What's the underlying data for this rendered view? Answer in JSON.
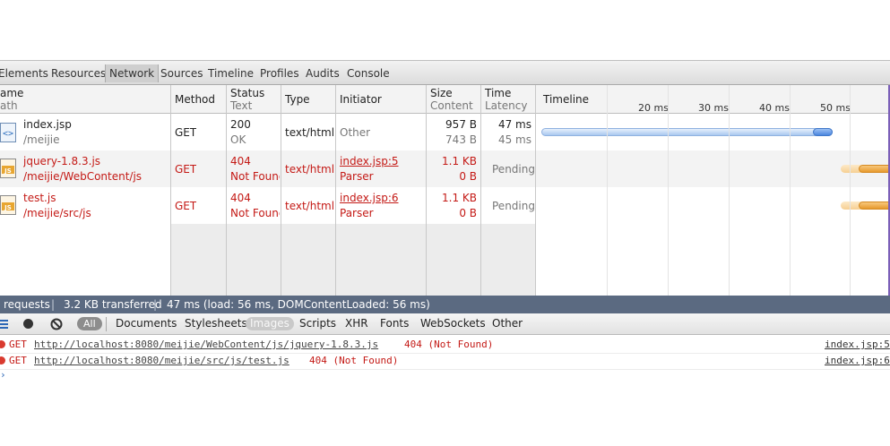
{
  "tabs": [
    "Elements",
    "Resources",
    "Network",
    "Sources",
    "Timeline",
    "Profiles",
    "Audits",
    "Console"
  ],
  "header": {
    "name": "ame",
    "path": "ath",
    "method": "Method",
    "status": "Status",
    "status_text": "Text",
    "type": "Type",
    "initiator": "Initiator",
    "size": "Size",
    "content": "Content",
    "time": "Time",
    "latency": "Latency",
    "timeline": "Timeline",
    "ticks": [
      "20 ms",
      "30 ms",
      "40 ms",
      "50 ms"
    ]
  },
  "rows": [
    {
      "name": "index.jsp",
      "path": "/meijie",
      "method": "GET",
      "status": "200",
      "status_text": "OK",
      "type": "text/html",
      "initiator": "Other",
      "initiator_sub": "",
      "size": "957 B",
      "content": "743 B",
      "time": "47 ms",
      "latency": "45 ms",
      "error": false
    },
    {
      "name": "jquery-1.8.3.js",
      "path": "/meijie/WebContent/js",
      "method": "GET",
      "status": "404",
      "status_text": "Not Found",
      "type": "text/html",
      "initiator": "index.jsp:5",
      "initiator_sub": "Parser",
      "size": "1.1 KB",
      "content": "0 B",
      "time": "Pending",
      "latency": "",
      "error": true
    },
    {
      "name": "test.js",
      "path": "/meijie/src/js",
      "method": "GET",
      "status": "404",
      "status_text": "Not Found",
      "type": "text/html",
      "initiator": "index.jsp:6",
      "initiator_sub": "Parser",
      "size": "1.1 KB",
      "content": "0 B",
      "time": "Pending",
      "latency": "",
      "error": true
    }
  ],
  "statusbar": {
    "requests": "requests",
    "transferred": "3.2 KB transferred",
    "timing": "47 ms (load: 56 ms, DOMContentLoaded: 56 ms)"
  },
  "filters": {
    "all": "All",
    "items": [
      "Documents",
      "Stylesheets",
      "Images",
      "Scripts",
      "XHR",
      "Fonts",
      "WebSockets",
      "Other"
    ]
  },
  "console": [
    {
      "method": "GET",
      "url": "http://localhost:8080/meijie/WebContent/js/jquery-1.8.3.js",
      "status": "404 (Not Found)",
      "source": "index.jsp:5"
    },
    {
      "method": "GET",
      "url": "http://localhost:8080/meijie/src/js/test.js",
      "status": "404 (Not Found)",
      "source": "index.jsp:6"
    }
  ],
  "colors": {
    "error": "#c41a16",
    "statusbar": "#5b6a81",
    "timeline_bar": "#8fb5ec",
    "pending_bar": "#f0b15a"
  }
}
